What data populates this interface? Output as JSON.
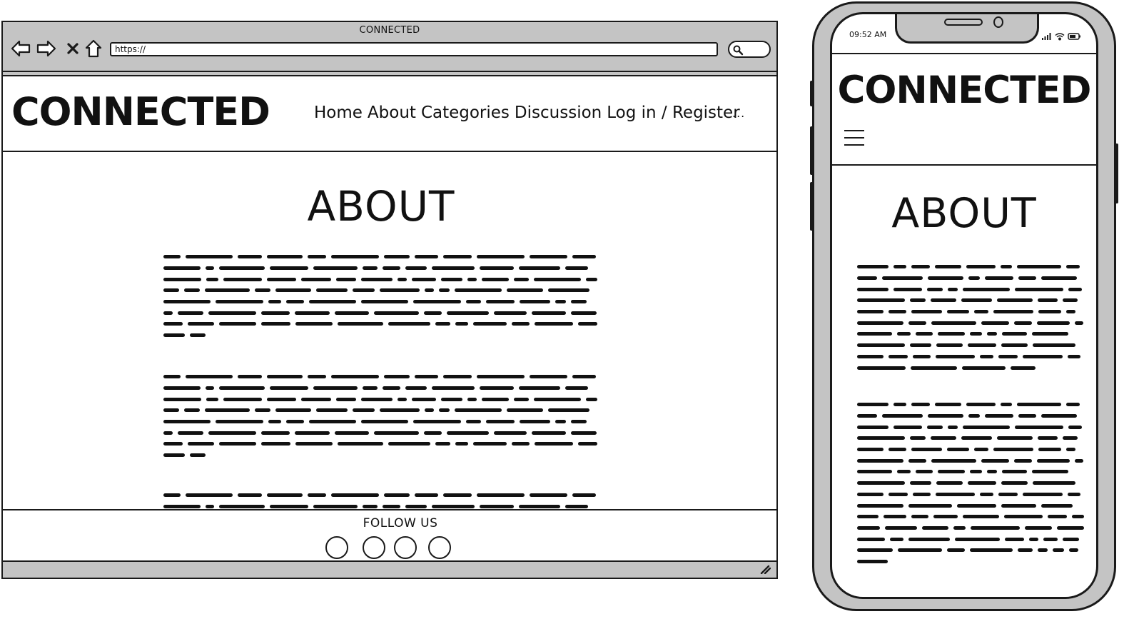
{
  "desktop": {
    "window_title": "CONNECTED",
    "url": "https://",
    "brand": "CONNECTED",
    "nav": [
      "Home",
      "About",
      "Categories",
      "Discussion",
      "Log in / Register"
    ],
    "nav_more": "...",
    "page_title": "ABOUT",
    "footer": {
      "follow_label": "FOLLOW US",
      "social_icons": [
        "social-icon-1",
        "social-icon-2",
        "social-icon-3",
        "social-icon-4"
      ]
    }
  },
  "mobile": {
    "status_time": "09:52 AM",
    "brand": "CONNECTED",
    "page_title": "ABOUT"
  },
  "colors": {
    "chrome": "#c4c4c4",
    "ink": "#1a1a1a",
    "page": "#ffffff"
  }
}
